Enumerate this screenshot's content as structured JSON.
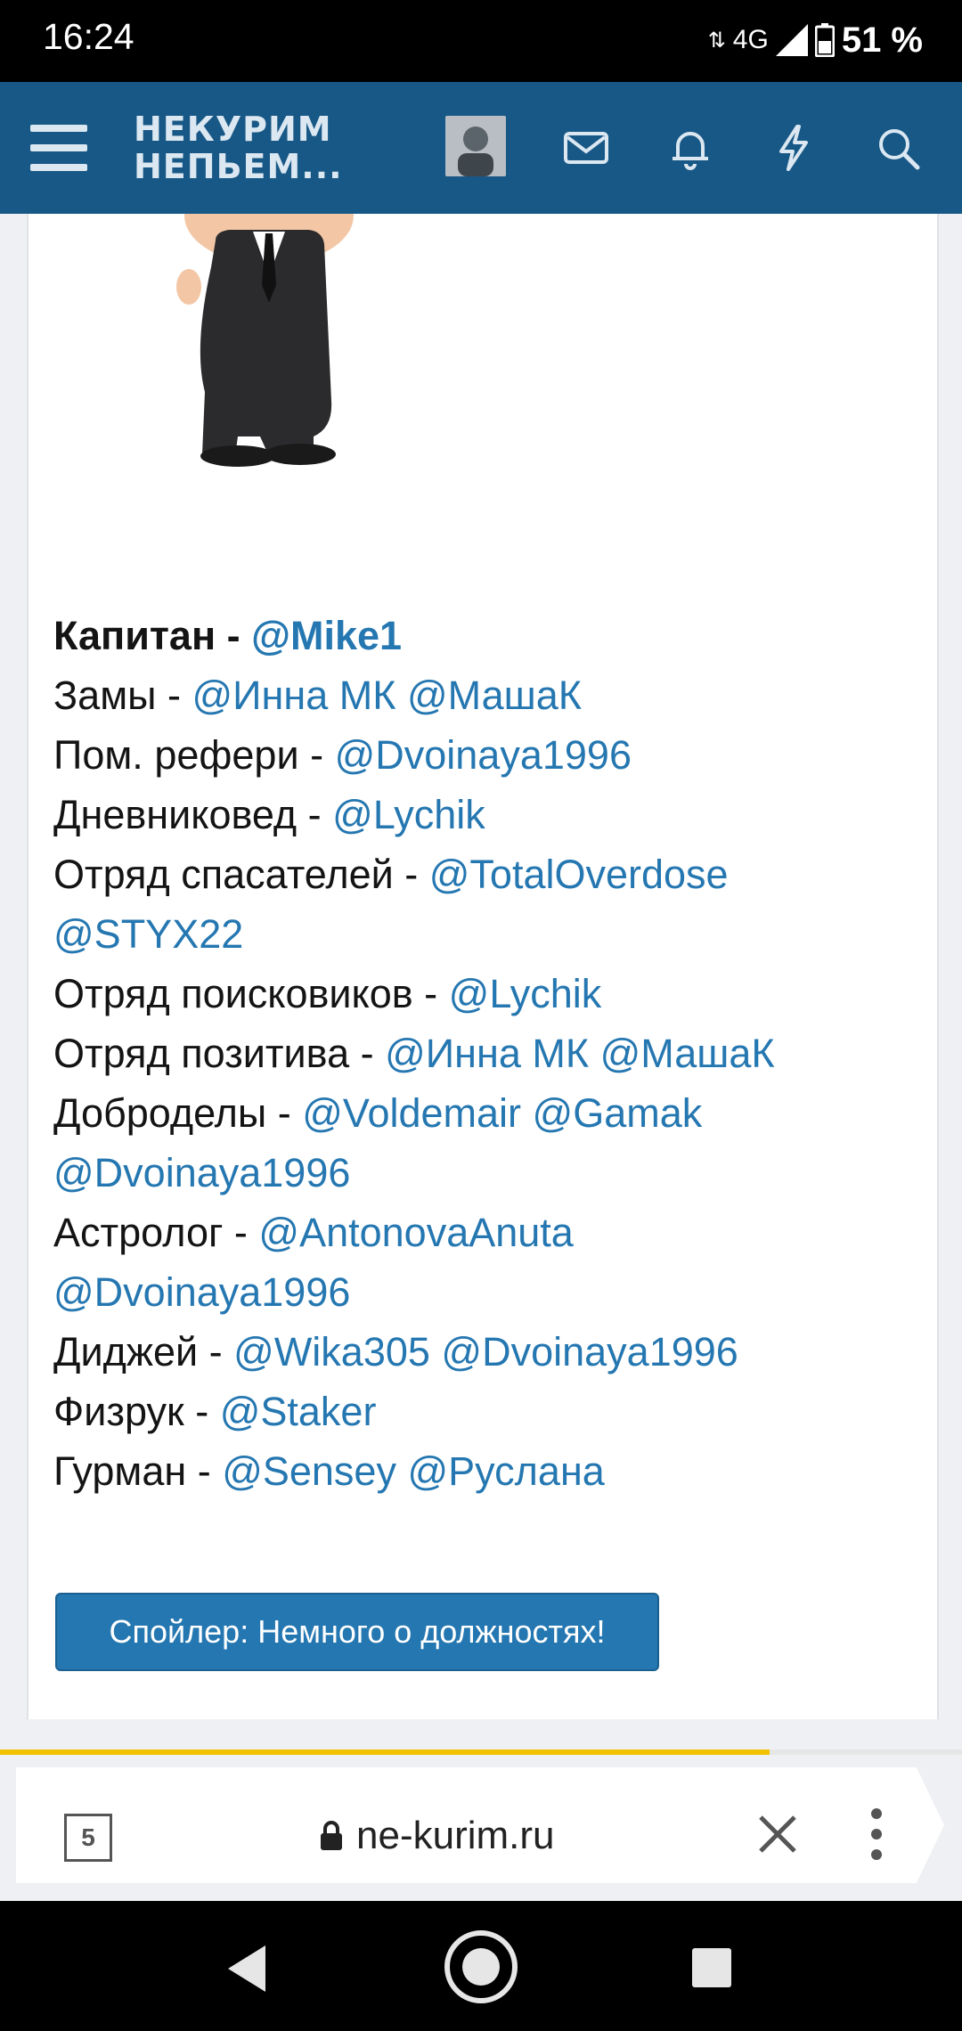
{
  "status_bar": {
    "time": "16:24",
    "network": "4G",
    "battery": "51 %"
  },
  "app_bar": {
    "logo_line1": "НЕКУРИМ",
    "logo_line2": "НЕПЬЕМ..."
  },
  "post": {
    "roles": [
      {
        "label": "Капитан - ",
        "bold": true,
        "mentions": [
          "@Mike1"
        ]
      },
      {
        "label": "Замы - ",
        "mentions": [
          "@Инна МК",
          "@МашаК"
        ]
      },
      {
        "label": "Пом. рефери - ",
        "mentions": [
          "@Dvoinaya1996"
        ]
      },
      {
        "label": "Дневниковед - ",
        "mentions": [
          "@Lychik"
        ]
      },
      {
        "label": "Отряд спасателей - ",
        "mentions": [
          "@TotalOverdose",
          "@STYX22"
        ]
      },
      {
        "label": "Отряд поисковиков - ",
        "mentions": [
          "@Lychik"
        ]
      },
      {
        "label": "Отряд позитива - ",
        "mentions": [
          "@Инна МК",
          "@МашаК"
        ]
      },
      {
        "label": "Доброделы - ",
        "mentions": [
          "@Voldemair",
          "@Gamak",
          "@Dvoinaya1996"
        ]
      },
      {
        "label": "Астролог - ",
        "mentions": [
          "@AntonovaAnuta",
          "@Dvoinaya1996"
        ]
      },
      {
        "label": "Диджей - ",
        "mentions": [
          "@Wika305",
          "@Dvoinaya1996"
        ]
      },
      {
        "label": "Физрук - ",
        "mentions": [
          "@Staker"
        ]
      },
      {
        "label": "Гурман - ",
        "mentions": [
          "@Sensey",
          "@Руслана"
        ]
      }
    ],
    "spoiler_label": "Спойлер: Немного о должностях!"
  },
  "browser": {
    "tab_count": "5",
    "url": "ne-kurim.ru",
    "page_load_progress": 0.8
  },
  "colors": {
    "header": "#185886",
    "link": "#2577b1",
    "progress": "#f2c200"
  }
}
